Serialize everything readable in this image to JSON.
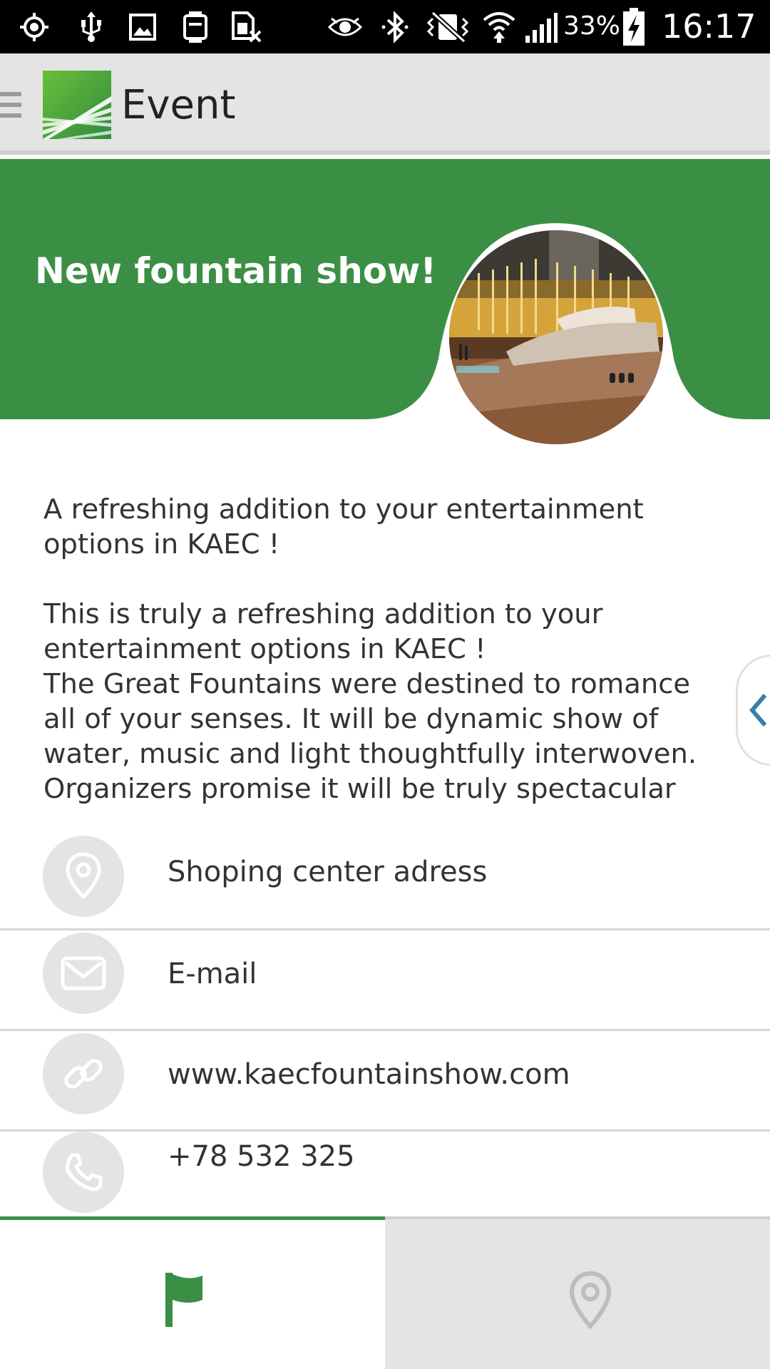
{
  "status_bar": {
    "battery": "33%",
    "time": "16:17",
    "icons": [
      "gps-icon",
      "usb-icon",
      "image-icon",
      "watch-icon",
      "sim-off-icon",
      "eye-icon",
      "bluetooth-icon",
      "vibrate-mute-icon",
      "wifi-icon",
      "signal-icon",
      "battery-charging-icon"
    ]
  },
  "app_bar": {
    "title": "Event",
    "menu_icon": "hamburger-icon",
    "logo": "app-logo"
  },
  "event": {
    "title": "New fountain show!",
    "description": "A refreshing addition to your entertainment options in KAEC !\n\nThis is truly a refreshing addition to your entertainment options in KAEC !\nThe Great Fountains were destined to romance all of your senses. It will be dynamic show of water, music and light thoughtfully interwoven.\nOrganizers promise it will be truly spectacular"
  },
  "contacts": [
    {
      "icon": "location-pin-icon",
      "label": "Shoping center adress"
    },
    {
      "icon": "email-icon",
      "label": "E-mail"
    },
    {
      "icon": "link-icon",
      "label": "www.kaecfountainshow.com"
    },
    {
      "icon": "phone-icon",
      "label": "+78 532 325"
    }
  ],
  "bottom_tabs": [
    {
      "icon": "flag-icon",
      "active": true
    },
    {
      "icon": "map-pin-icon",
      "active": false
    }
  ],
  "colors": {
    "brand_green": "#3b8f45",
    "appbar_bg": "#e4e4e4",
    "icon_gray": "#c9c9c9"
  }
}
